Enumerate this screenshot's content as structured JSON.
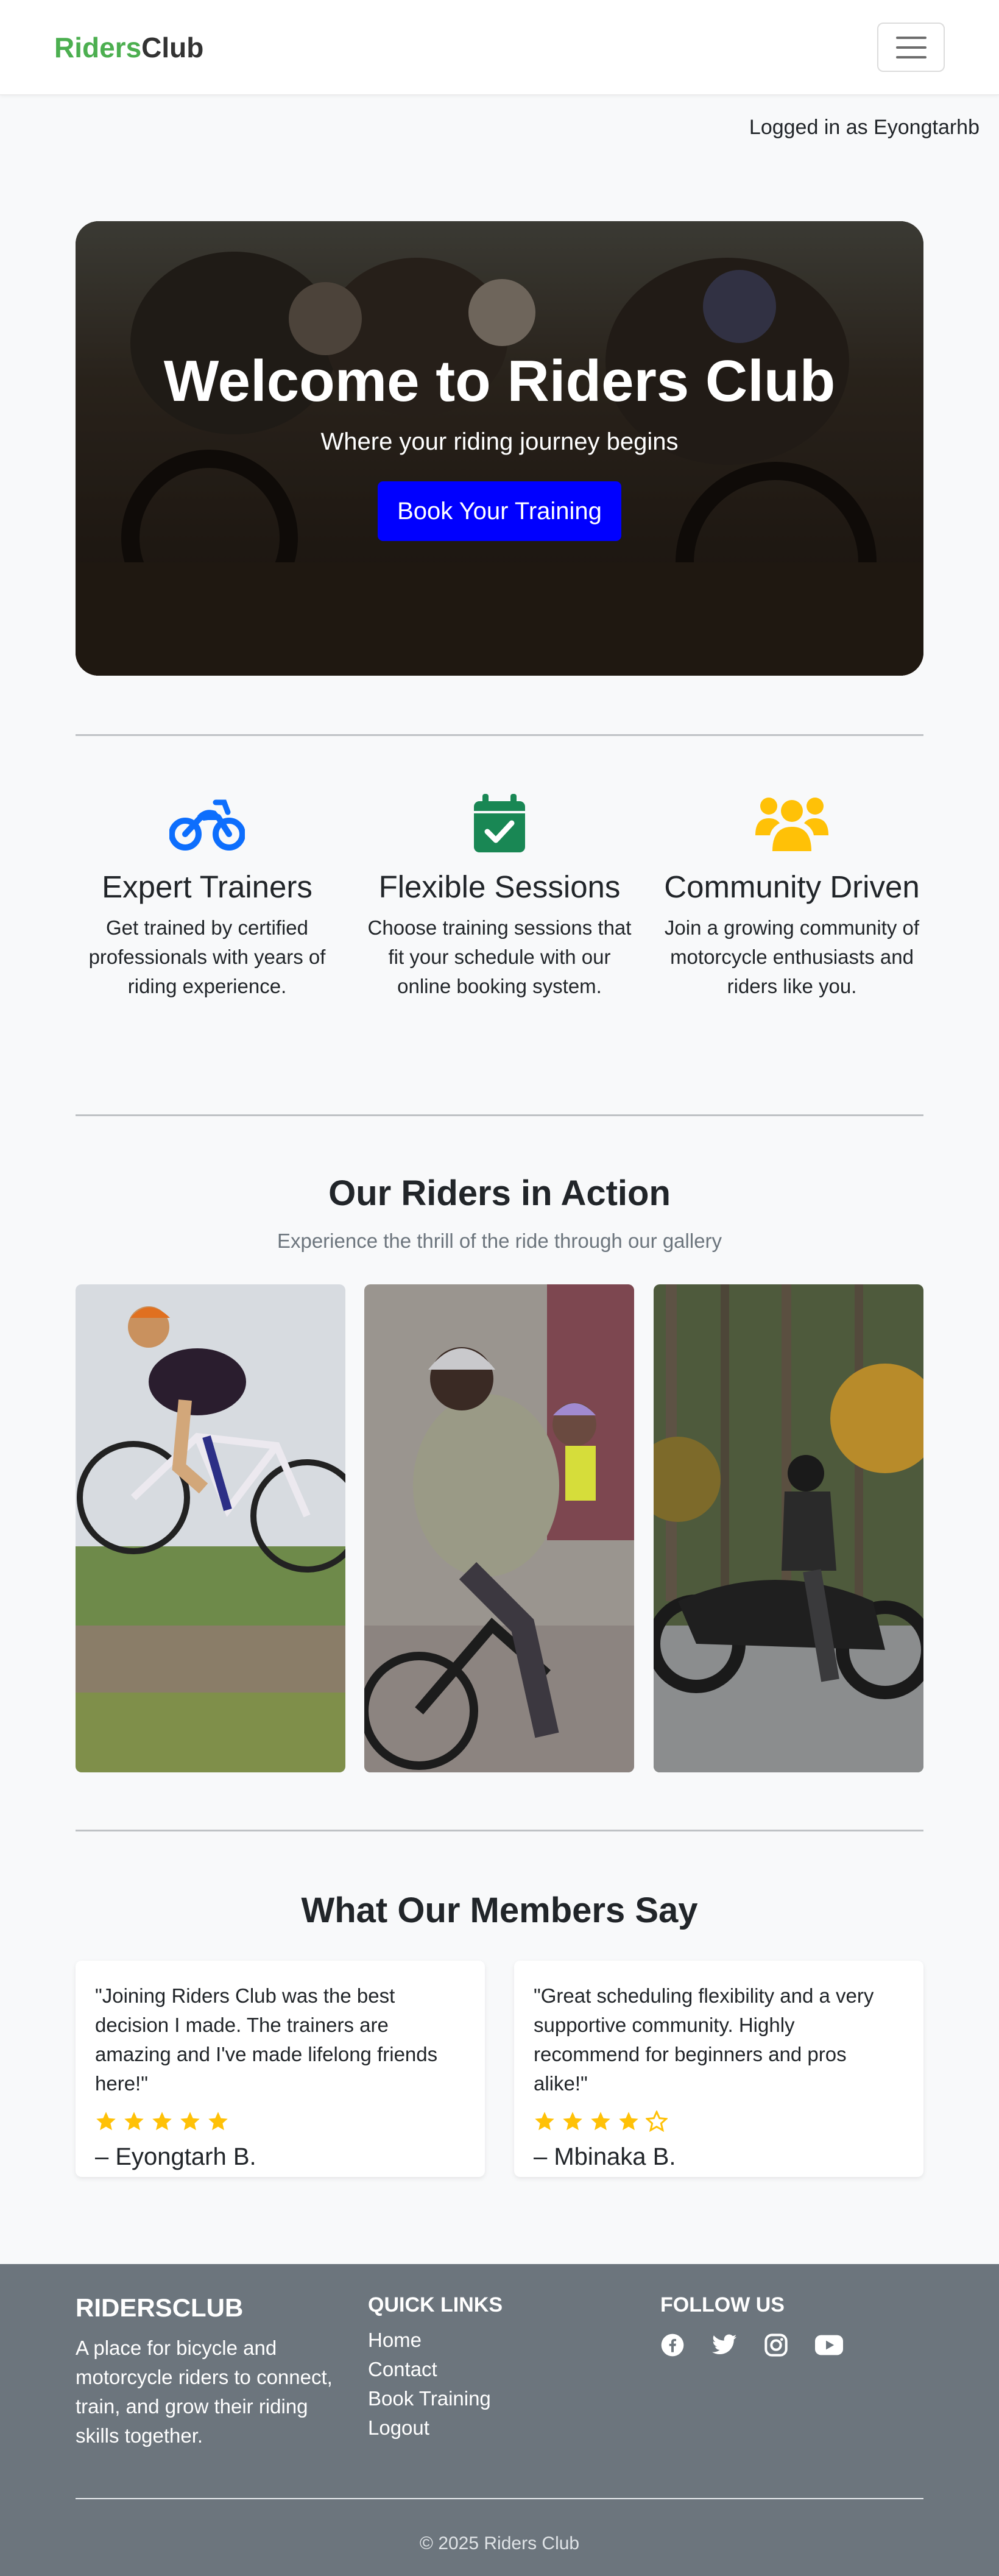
{
  "navbar": {
    "brand_part1": "Riders",
    "brand_part2": "Club",
    "menu_icon": "hamburger-icon"
  },
  "user_status": "Logged in as Eyongtarhb",
  "hero": {
    "title": "Welcome to Riders Club",
    "subtitle": "Where your riding journey begins",
    "cta_label": "Book Your Training",
    "cta_color": "#0000ff"
  },
  "features": [
    {
      "icon": "motorcycle-icon",
      "title": "Expert Trainers",
      "text": "Get trained by certified professionals with years of riding experience.",
      "color": "#0d6efd"
    },
    {
      "icon": "calendar-check-icon",
      "title": "Flexible Sessions",
      "text": "Choose training sessions that fit your schedule with our online booking system.",
      "color": "#198754"
    },
    {
      "icon": "users-icon",
      "title": "Community Driven",
      "text": "Join a growing community of motorcycle enthusiasts and riders like you.",
      "color": "#ffc107"
    }
  ],
  "gallery": {
    "title": "Our Riders in Action",
    "subtitle": "Experience the thrill of the ride through our gallery"
  },
  "testimonials": {
    "title": "What Our Members Say",
    "items": [
      {
        "quote": "\"Joining Riders Club was the best decision I made. The trainers are amazing and I've made lifelong friends here!\"",
        "rating": 5,
        "author": "– Eyongtarh B."
      },
      {
        "quote": "\"Great scheduling flexibility and a very supportive community. Highly recommend for beginners and pros alike!\"",
        "rating": 4,
        "author": "– Mbinaka B."
      }
    ],
    "star_color": "#ffc107"
  },
  "footer": {
    "about_title": "RIDERSCLUB",
    "about_text": "A place for bicycle and motorcycle riders to connect, train, and grow their riding skills together.",
    "links_title": "QUICK LINKS",
    "links": [
      "Home",
      "Contact",
      "Book Training",
      "Logout"
    ],
    "follow_title": "FOLLOW US",
    "socials": [
      "facebook-icon",
      "twitter-icon",
      "instagram-icon",
      "youtube-icon"
    ],
    "copyright": "© 2025 Riders Club"
  },
  "colors": {
    "brand_green": "#4caf50",
    "footer_bg": "#6c757d"
  }
}
